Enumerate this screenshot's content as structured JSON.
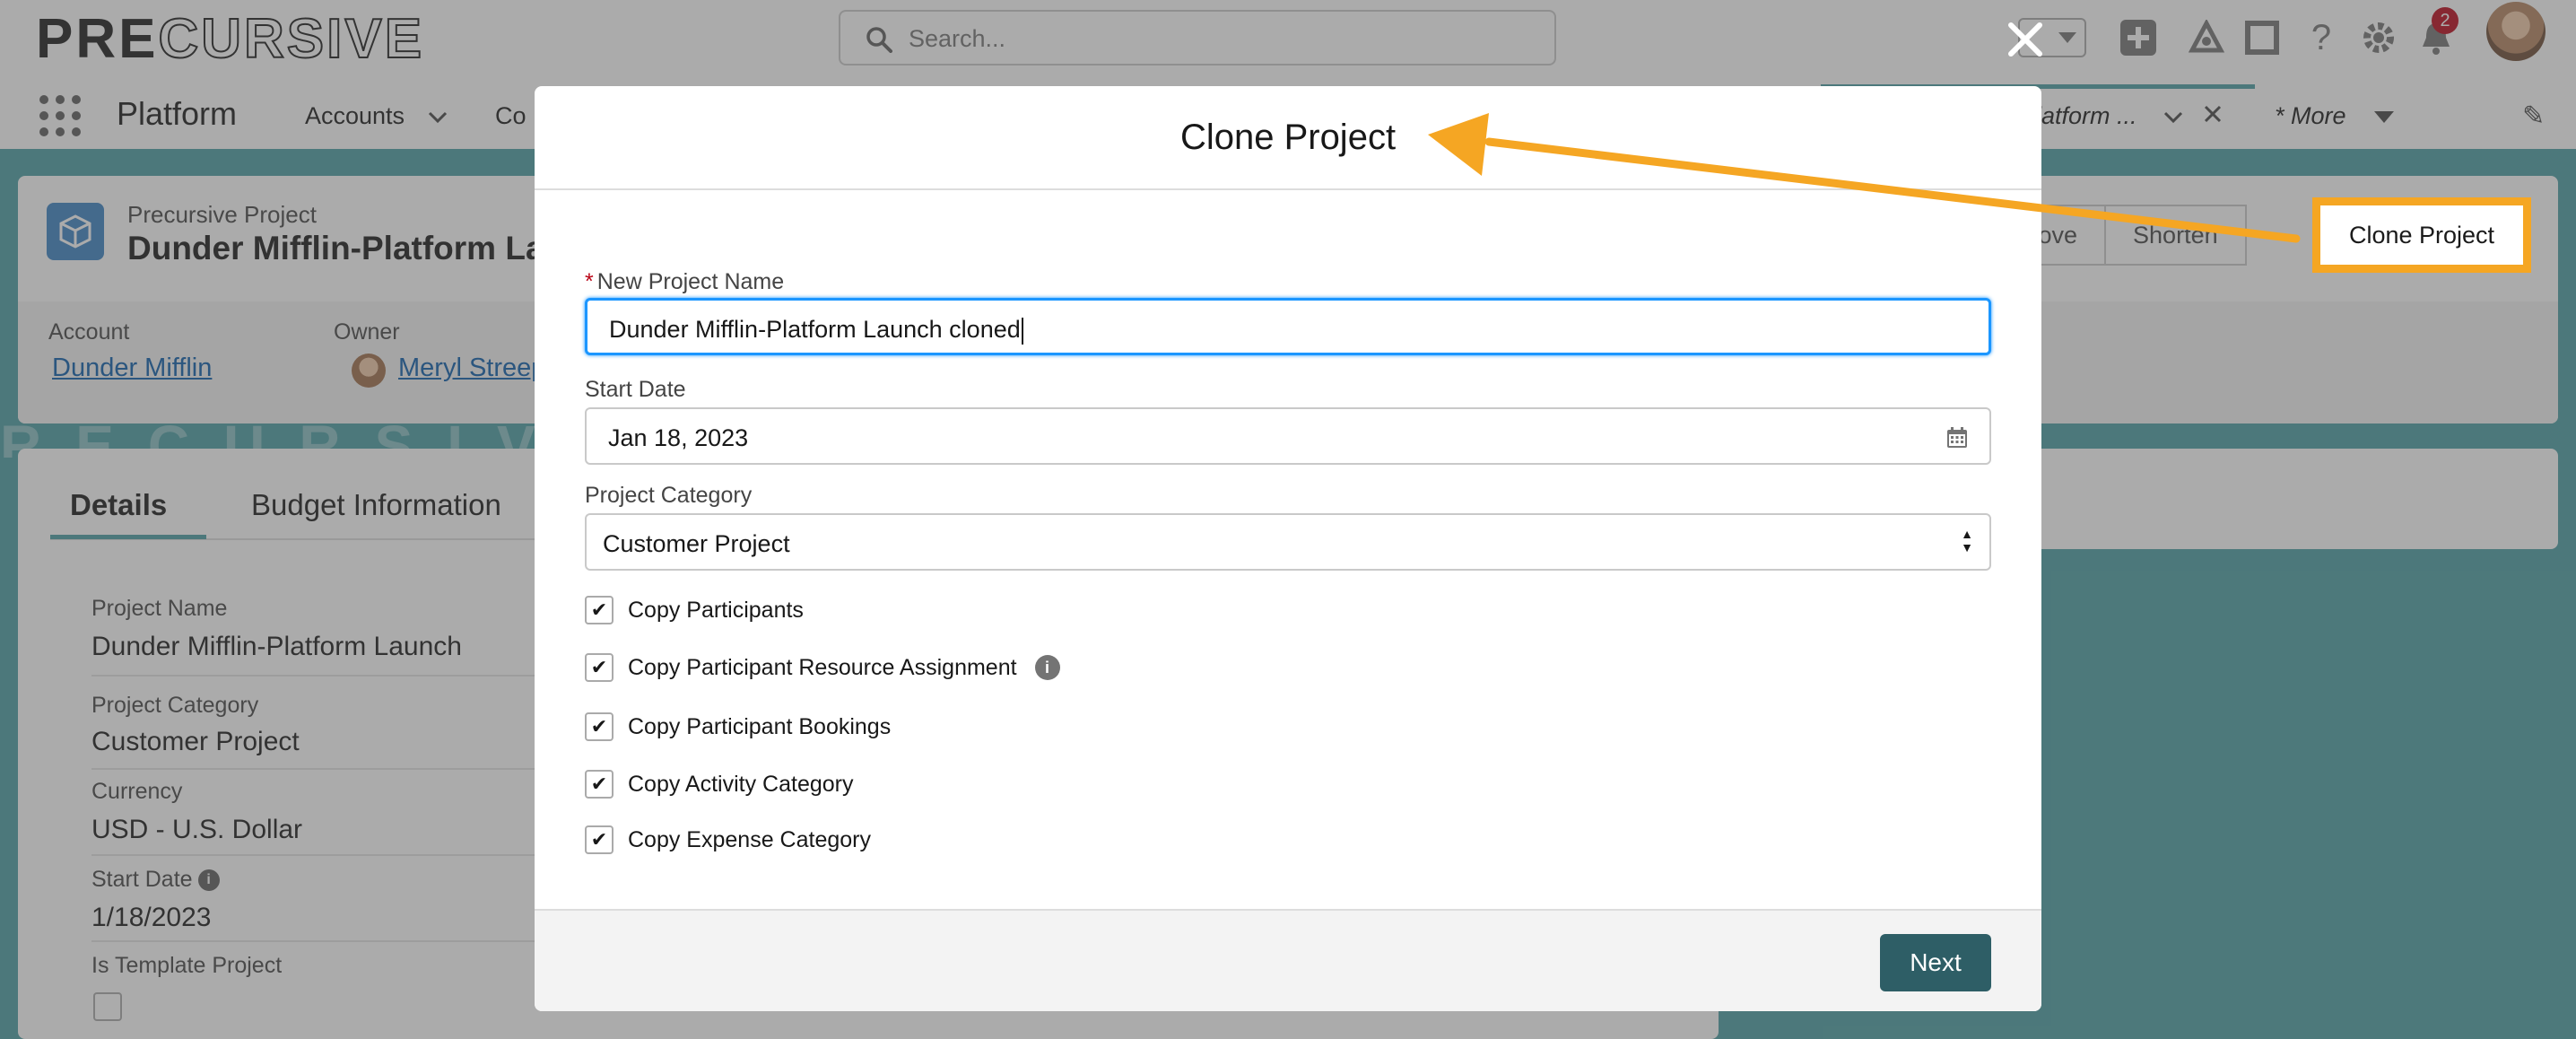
{
  "header": {
    "logo_dark": "PRE",
    "logo_outline": "CURSIVE",
    "search_placeholder": "Search...",
    "notification_count": "2"
  },
  "nav": {
    "app_name": "Platform",
    "items": [
      "Accounts",
      "Co"
    ],
    "active_tab": "latform ...",
    "more": "* More"
  },
  "record": {
    "type": "Precursive Project",
    "title": "Dunder Mifflin-Platform La",
    "account_label": "Account",
    "account_value": "Dunder Mifflin",
    "owner_label": "Owner",
    "owner_value": "Meryl Streep",
    "actions": [
      "Move",
      "Shorten"
    ],
    "clone_action": "Clone Project"
  },
  "details": {
    "tabs": [
      "Details",
      "Budget Information"
    ],
    "fields": [
      {
        "label": "Project Name",
        "value": "Dunder Mifflin-Platform Launch"
      },
      {
        "label": "Project Category",
        "value": "Customer Project"
      },
      {
        "label": "Currency",
        "value": "USD - U.S. Dollar"
      },
      {
        "label": "Start Date",
        "value": "1/18/2023"
      },
      {
        "label": "Is Template Project",
        "value": ""
      }
    ]
  },
  "deco_text": "RECURSIVE PRECURSIVE",
  "modal": {
    "title": "Clone Project",
    "name_label": "New Project Name",
    "name_value": "Dunder Mifflin-Platform Launch cloned",
    "start_label": "Start Date",
    "start_value": "Jan 18, 2023",
    "category_label": "Project Category",
    "category_value": "Customer Project",
    "checkboxes": [
      {
        "label": "Copy Participants",
        "checked": true
      },
      {
        "label": "Copy Participant Resource Assignment",
        "checked": true,
        "info": true
      },
      {
        "label": "Copy Participant Bookings",
        "checked": true
      },
      {
        "label": "Copy Activity Category",
        "checked": true
      },
      {
        "label": "Copy Expense Category",
        "checked": true
      }
    ],
    "next_label": "Next"
  },
  "colors": {
    "accent": "#4a9ea3",
    "highlight": "#f5a623",
    "next_button": "#2e5e66",
    "link": "#0b5cab"
  }
}
